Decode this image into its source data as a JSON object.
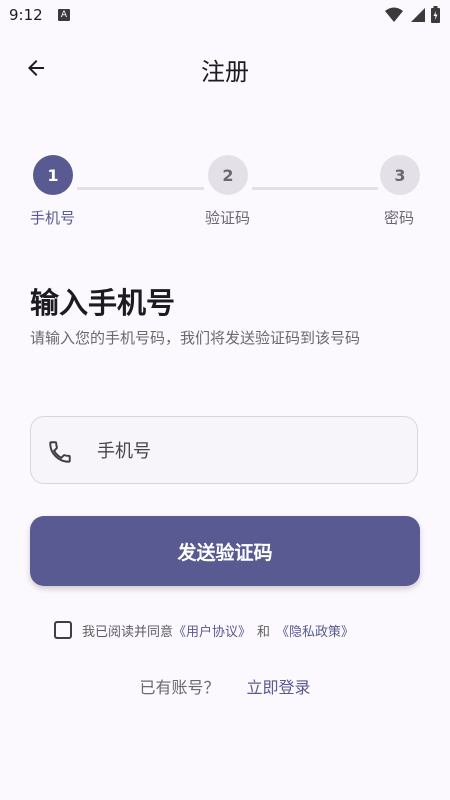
{
  "status": {
    "time": "9:12",
    "notif_icon_letter": "A"
  },
  "appbar": {
    "title": "注册"
  },
  "stepper": {
    "steps": [
      {
        "number": "1",
        "label": "手机号",
        "active": true
      },
      {
        "number": "2",
        "label": "验证码",
        "active": false
      },
      {
        "number": "3",
        "label": "密码",
        "active": false
      }
    ]
  },
  "main": {
    "heading": "输入手机号",
    "subtext": "请输入您的手机号码，我们将发送验证码到该号码",
    "phone_placeholder": "手机号",
    "send_button": "发送验证码"
  },
  "agreement": {
    "prefix": "我已阅读并同意",
    "user_agreement": "《用户协议》",
    "conjunction": "和",
    "privacy_policy": "《隐私政策》",
    "checked": false
  },
  "login": {
    "question": "已有账号？",
    "link": "立即登录"
  },
  "colors": {
    "primary": "#595A92",
    "background": "#FBF8FE",
    "inactive_step": "#E3E1E7"
  },
  "icons": [
    "back-arrow-icon",
    "phone-icon",
    "wifi-icon",
    "signal-icon",
    "battery-icon"
  ]
}
